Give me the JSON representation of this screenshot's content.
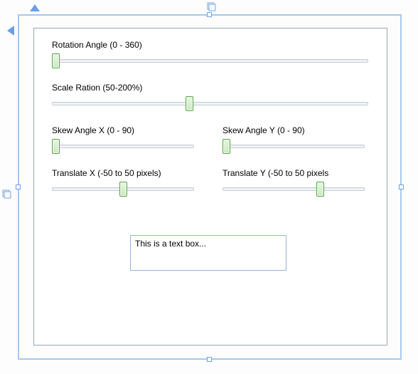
{
  "labels": {
    "rotation": "Rotation Angle (0 - 360)",
    "scale": "Scale Ration (50-200%)",
    "skewX": "Skew Angle X (0 - 90)",
    "skewY": "Skew Angle Y (0 - 90)",
    "transX": "Translate X (-50 to 50 pixels)",
    "transY": "Translate Y (-50 to 50 pixels"
  },
  "sliders": {
    "rotation": {
      "min": 0,
      "max": 360,
      "value": 0
    },
    "scale": {
      "min": 50,
      "max": 200,
      "value": 115
    },
    "skewX": {
      "min": 0,
      "max": 90,
      "value": 0
    },
    "skewY": {
      "min": 0,
      "max": 90,
      "value": 0
    },
    "transX": {
      "min": -50,
      "max": 50,
      "value": 0
    },
    "transY": {
      "min": -50,
      "max": 50,
      "value": 20
    }
  },
  "textbox": {
    "value": "This is a text box..."
  }
}
